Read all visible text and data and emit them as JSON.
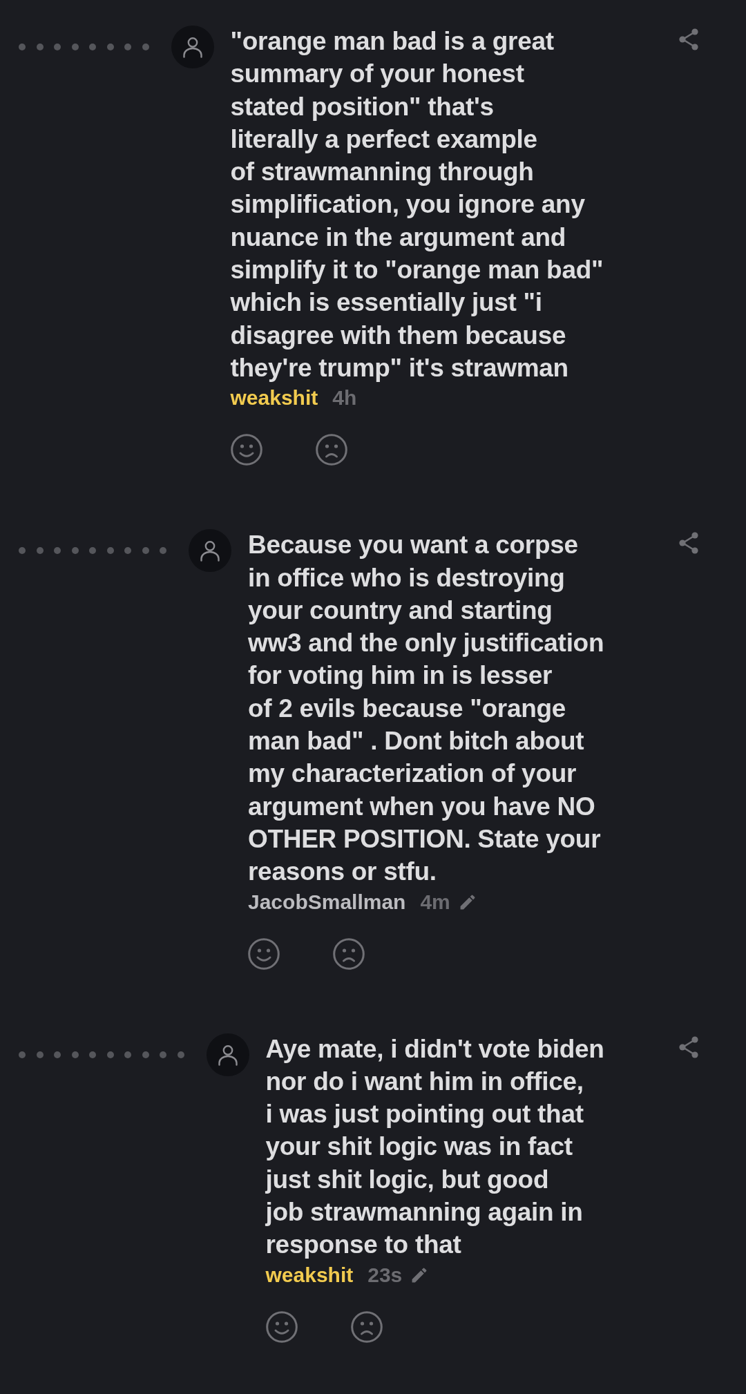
{
  "comments": [
    {
      "text": "\"orange man bad is a great\nsummary of your honest\nstated position\" that's\nliterally a perfect example\nof strawmanning through\nsimplification, you ignore any\nnuance in the argument and\nsimplify it to \"orange man bad\"\nwhich is essentially just \"i\ndisagree with them because\nthey're trump\" it's strawman",
      "author": "weakshit",
      "color": "#f2cb4f",
      "time": "4h",
      "edited": false,
      "children": [
        {
          "text": "Because you want a corpse\nin office who is destroying\nyour country and starting\nww3 and the only justification\nfor voting him in is lesser\nof 2 evils because \"orange\nman bad\" . Dont bitch about\nmy characterization of your\nargument when you have NO\nOTHER POSITION. State your\nreasons or stfu.",
          "author": "JacobSmallman",
          "color": "#bcbcc0",
          "time": "4m",
          "edited": true,
          "children": [
            {
              "text": "Aye mate, i didn't vote biden\nnor do i want him in office,\ni was just pointing out that\nyour shit logic was in fact\njust shit logic, but good\njob strawmanning again in\nresponse to that",
              "author": "weakshit",
              "color": "#f2cb4f",
              "time": "23s",
              "edited": true
            }
          ]
        }
      ]
    }
  ]
}
